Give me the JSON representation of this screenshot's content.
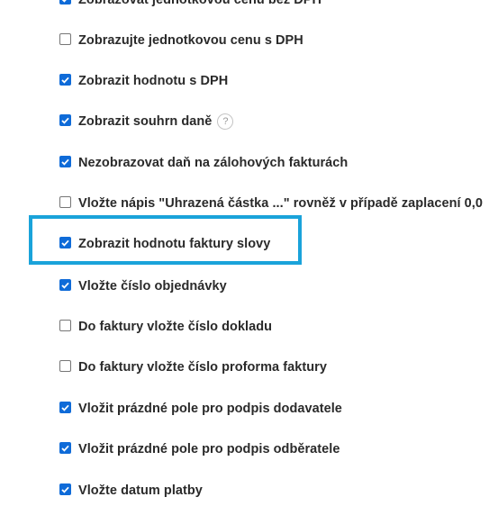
{
  "options": [
    {
      "label": "Zobrazovat jednotkovou cenu bez DPH",
      "checked": true
    },
    {
      "label": "Zobrazujte jednotkovou cenu s DPH",
      "checked": false
    },
    {
      "label": "Zobrazit hodnotu s DPH",
      "checked": true
    },
    {
      "label": "Zobrazit souhrn daně",
      "checked": true,
      "help": "?"
    },
    {
      "label": "Nezobrazovat daň na zálohových fakturách",
      "checked": true
    },
    {
      "label": "Vložte nápis \"Uhrazená částka ...\" rovněž v případě zaplacení 0,0",
      "checked": false
    },
    {
      "label": "Zobrazit hodnotu faktury slovy",
      "checked": true
    },
    {
      "label": "Vložte číslo objednávky",
      "checked": true
    },
    {
      "label": "Do faktury vložte číslo dokladu",
      "checked": false
    },
    {
      "label": "Do faktury vložte číslo proforma faktury",
      "checked": false
    },
    {
      "label": "Vložit prázdné pole pro podpis dodavatele",
      "checked": true
    },
    {
      "label": "Vložit prázdné pole pro podpis odběratele",
      "checked": true
    },
    {
      "label": "Vložte datum platby",
      "checked": true
    }
  ],
  "highlighted_option": "Zobrazit hodnotu faktury slovy",
  "colors": {
    "checkbox_checked": "#0f6bd8",
    "highlight_border": "#1aa3da",
    "label_text": "#2a2a2a"
  }
}
